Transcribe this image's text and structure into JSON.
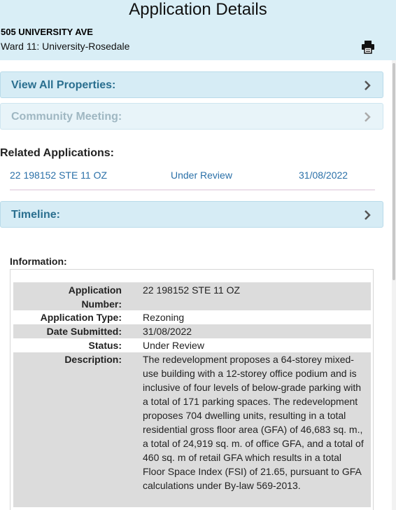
{
  "header": {
    "title": "Application Details",
    "address": "505 UNIVERSITY AVE",
    "ward": "Ward 11: University-Rosedale",
    "print_icon": "printer-icon"
  },
  "panels": {
    "view_all_properties": "View All Properties:",
    "community_meeting": "Community Meeting:",
    "timeline": "Timeline:"
  },
  "related": {
    "heading": "Related Applications:",
    "items": [
      {
        "number": "22 198152 STE 11 OZ",
        "status": "Under Review",
        "date": "31/08/2022"
      }
    ]
  },
  "information": {
    "heading": "Information:",
    "rows": [
      {
        "label": "Application Number:",
        "value": "22 198152 STE 11 OZ"
      },
      {
        "label": "Application Type:",
        "value": "Rezoning"
      },
      {
        "label": "Date Submitted:",
        "value": "31/08/2022"
      },
      {
        "label": "Status:",
        "value": "Under Review"
      },
      {
        "label": "Description:",
        "value": "The redevelopment proposes a 64-storey mixed-use building with a 12-storey office podium and is inclusive of four levels of below-grade parking with a total of 171 parking spaces. The redevelopment proposes 704 dwelling units, resulting in a total residential gross floor area (GFA) of 46,683 sq. m., a total of 24,919 sq. m. of office GFA, and a total of 460 sq. m of retail GFA which results in a total Floor Space Index (FSI) of 21.65, pursuant to GFA calculations under By-law 569-2013."
      }
    ]
  },
  "colors": {
    "header_bg": "#d9eef6",
    "panel_bg": "#d6ecf5",
    "panel_text": "#2a6f8f",
    "link": "#2a70a8",
    "row_shade": "#dcdcdc"
  }
}
